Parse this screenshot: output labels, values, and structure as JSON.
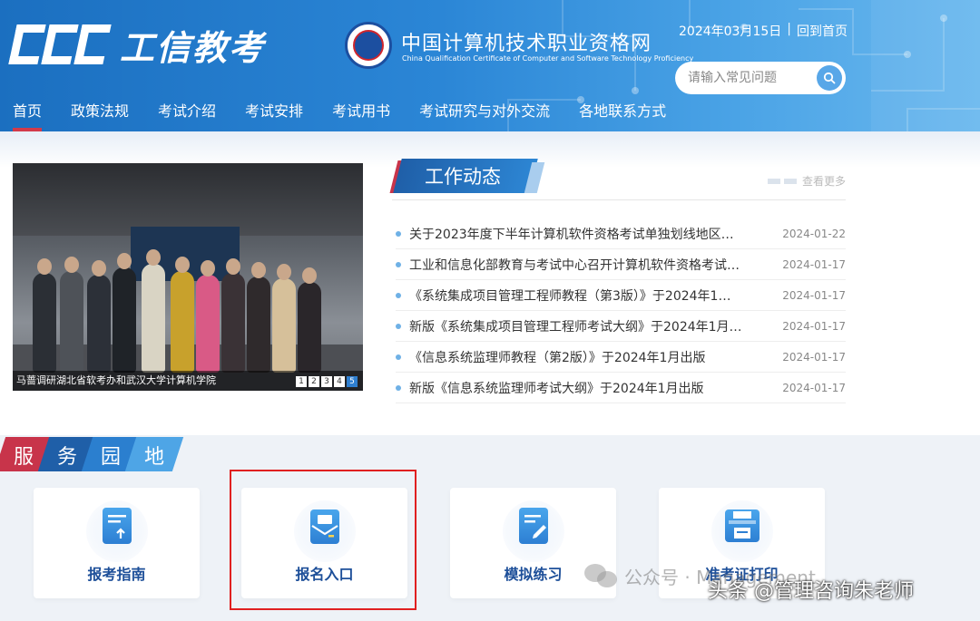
{
  "header": {
    "logo_text": "工信教考",
    "site_title": "中国计算机技术职业资格网",
    "site_subtitle": "China Qualification Certificate of Computer and Software Technology Proficiency",
    "date": "2024年03月15日",
    "separator": "|",
    "home_link": "回到首页",
    "colors": {
      "primary": "#1b6fc0",
      "accent_red": "#d23a4a"
    }
  },
  "search": {
    "placeholder": "请输入常见问题"
  },
  "nav": {
    "items": [
      {
        "label": "首页",
        "active": true
      },
      {
        "label": "政策法规"
      },
      {
        "label": "考试介绍"
      },
      {
        "label": "考试安排"
      },
      {
        "label": "考试用书"
      },
      {
        "label": "考试研究与对外交流"
      },
      {
        "label": "各地联系方式"
      }
    ]
  },
  "slider": {
    "caption": "马蔷调研湖北省软考办和武汉大学计算机学院",
    "pages": [
      "1",
      "2",
      "3",
      "4",
      "5"
    ],
    "active_page": "5"
  },
  "news": {
    "title": "工作动态",
    "more": "查看更多",
    "items": [
      {
        "title": "关于2023年度下半年计算机软件资格考试单独划线地区…",
        "date": "2024-01-22"
      },
      {
        "title": "工业和信息化部教育与考试中心召开计算机软件资格考试…",
        "date": "2024-01-17"
      },
      {
        "title": "《系统集成项目管理工程师教程（第3版）》于2024年1…",
        "date": "2024-01-17"
      },
      {
        "title": "新版《系统集成项目管理工程师考试大纲》于2024年1月…",
        "date": "2024-01-17"
      },
      {
        "title": "《信息系统监理师教程（第2版）》于2024年1月出版",
        "date": "2024-01-17"
      },
      {
        "title": "新版《信息系统监理师考试大纲》于2024年1月出版",
        "date": "2024-01-17"
      }
    ]
  },
  "service": {
    "chars": [
      "服",
      "务",
      "园",
      "地"
    ],
    "cards": [
      {
        "label": "报考指南",
        "icon": "document-upload-icon"
      },
      {
        "label": "报名入口",
        "icon": "envelope-icon"
      },
      {
        "label": "模拟练习",
        "icon": "edit-document-icon"
      },
      {
        "label": "准考证打印",
        "icon": "printer-icon"
      }
    ]
  },
  "watermark": {
    "wechat": "公众号 · Management",
    "toutiao": "头条 @管理咨询朱老师"
  }
}
